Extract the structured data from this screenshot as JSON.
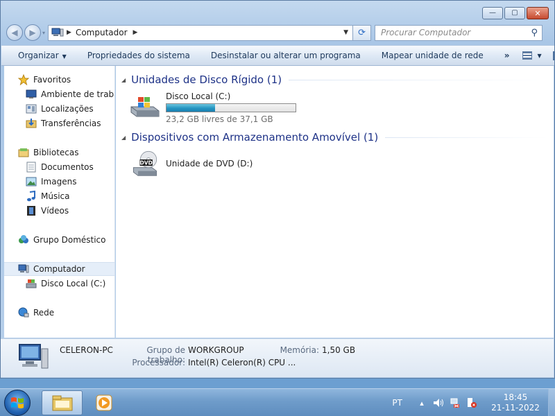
{
  "window": {
    "minimize_glyph": "—",
    "maximize_glyph": "▢",
    "close_glyph": "✕"
  },
  "navigation": {
    "back_glyph": "◀",
    "forward_glyph": "▶",
    "history_dropdown_glyph": "▾",
    "address": {
      "breadcrumb": "Computador",
      "icon": "computer-icon"
    },
    "refresh_glyph": "⟳",
    "search": {
      "placeholder": "Procurar Computador",
      "value": ""
    }
  },
  "command_bar": {
    "organize_label": "Organizar",
    "system_properties_label": "Propriedades do sistema",
    "uninstall_label": "Desinstalar ou alterar um programa",
    "map_drive_label": "Mapear unidade de rede",
    "more_label": "»",
    "help_label": "?"
  },
  "sidebar": {
    "favorites": {
      "label": "Favoritos",
      "items": [
        {
          "label": "Ambiente de trabalho",
          "icon": "desktop-icon"
        },
        {
          "label": "Localizações",
          "icon": "places-icon"
        },
        {
          "label": "Transferências",
          "icon": "downloads-icon"
        }
      ]
    },
    "libraries": {
      "label": "Bibliotecas",
      "items": [
        {
          "label": "Documentos",
          "icon": "documents-icon"
        },
        {
          "label": "Imagens",
          "icon": "pictures-icon"
        },
        {
          "label": "Música",
          "icon": "music-icon"
        },
        {
          "label": "Vídeos",
          "icon": "videos-icon"
        }
      ]
    },
    "homegroup": {
      "label": "Grupo Doméstico"
    },
    "computer": {
      "label": "Computador",
      "items": [
        {
          "label": "Disco Local (C:)",
          "icon": "local-disk-icon"
        }
      ]
    },
    "network": {
      "label": "Rede"
    }
  },
  "content": {
    "hard_drives_group": {
      "title": "Unidades de Disco Rígido (1)",
      "drives": [
        {
          "name": "Disco Local (C:)",
          "free_text": "23,2 GB livres de 37,1 GB",
          "used_fraction": 0.375
        }
      ]
    },
    "removable_group": {
      "title": "Dispositivos com Armazenamento Amovível (1)",
      "devices": [
        {
          "name": "Unidade de DVD (D:)",
          "icon_text": "DVD"
        }
      ]
    }
  },
  "details": {
    "computer_name": "CELERON-PC",
    "workgroup_label": "Grupo de trabalho:",
    "workgroup_value": "WORKGROUP",
    "memory_label": "Memória:",
    "memory_value": "1,50 GB",
    "processor_label": "Processador:",
    "processor_value": "Intel(R) Celeron(R) CPU ..."
  },
  "taskbar": {
    "language": "PT",
    "tray_arrow": "▴",
    "time": "18:45",
    "date": "21-11-2022"
  },
  "colors": {
    "group_title": "#1e3287",
    "progress_fill": "#2595c1",
    "selected_background": "#e5eef9"
  }
}
